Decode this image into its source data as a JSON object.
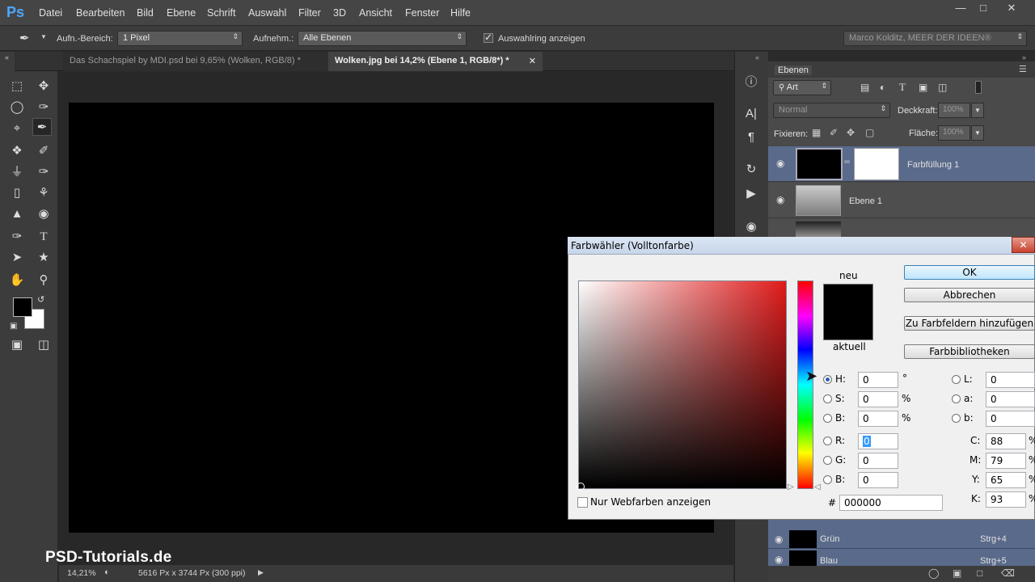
{
  "app": {
    "logo": "Ps"
  },
  "menu": [
    "Datei",
    "Bearbeiten",
    "Bild",
    "Ebene",
    "Schrift",
    "Auswahl",
    "Filter",
    "3D",
    "Ansicht",
    "Fenster",
    "Hilfe"
  ],
  "options": {
    "range_label": "Aufn.-Bereich:",
    "range_value": "1 Pixel",
    "sample_label": "Aufnehm.:",
    "sample_value": "Alle Ebenen",
    "show_ring_label": "Auswahlring anzeigen",
    "workspace_value": "Marco Kolditz, MEER DER IDEEN®"
  },
  "tabs": [
    {
      "label": "Das Schachspiel by MDI.psd bei 9,65% (Wolken, RGB/8) *"
    },
    {
      "label": "Wolken.jpg bei 14,2% (Ebene 1, RGB/8*) *"
    }
  ],
  "status": {
    "zoom": "14,21%",
    "doc_info": "5616 Px x 3744 Px (300 ppi)"
  },
  "watermark": "PSD-Tutorials.de",
  "layers_panel": {
    "title": "Ebenen",
    "filter_label": "Art",
    "blend_mode": "Normal",
    "opacity_label": "Deckkraft:",
    "opacity_value": "100%",
    "lock_label": "Fixieren:",
    "fill_label": "Fläche:",
    "fill_value": "100%",
    "layers": [
      {
        "name": "Farbfüllung 1"
      },
      {
        "name": "Ebene 1"
      }
    ],
    "channels": [
      {
        "name": "Grün",
        "shortcut": "Strg+4"
      },
      {
        "name": "Blau",
        "shortcut": "Strg+5"
      }
    ]
  },
  "color_picker": {
    "title": "Farbwähler (Volltonfarbe)",
    "ok": "OK",
    "cancel": "Abbrechen",
    "add_swatches": "Zu Farbfeldern hinzufügen",
    "libraries": "Farbbibliotheken",
    "new_label": "neu",
    "current_label": "aktuell",
    "web_only_label": "Nur Webfarben anzeigen",
    "hex_label": "#",
    "hex_value": "000000",
    "hsb": [
      {
        "label": "H:",
        "value": "0",
        "unit": "°",
        "selected": true
      },
      {
        "label": "S:",
        "value": "0",
        "unit": "%"
      },
      {
        "label": "B:",
        "value": "0",
        "unit": "%"
      }
    ],
    "rgb": [
      {
        "label": "R:",
        "value": "0"
      },
      {
        "label": "G:",
        "value": "0"
      },
      {
        "label": "B:",
        "value": "0"
      }
    ],
    "lab": [
      {
        "label": "L:",
        "value": "0"
      },
      {
        "label": "a:",
        "value": "0"
      },
      {
        "label": "b:",
        "value": "0"
      }
    ],
    "cmyk": [
      {
        "label": "C:",
        "value": "88",
        "unit": "%"
      },
      {
        "label": "M:",
        "value": "79",
        "unit": "%"
      },
      {
        "label": "Y:",
        "value": "65",
        "unit": "%"
      },
      {
        "label": "K:",
        "value": "93",
        "unit": "%"
      }
    ],
    "hue": 0
  },
  "colors": {
    "accent": "#4da6ff",
    "selection": "#5a6a8a"
  }
}
